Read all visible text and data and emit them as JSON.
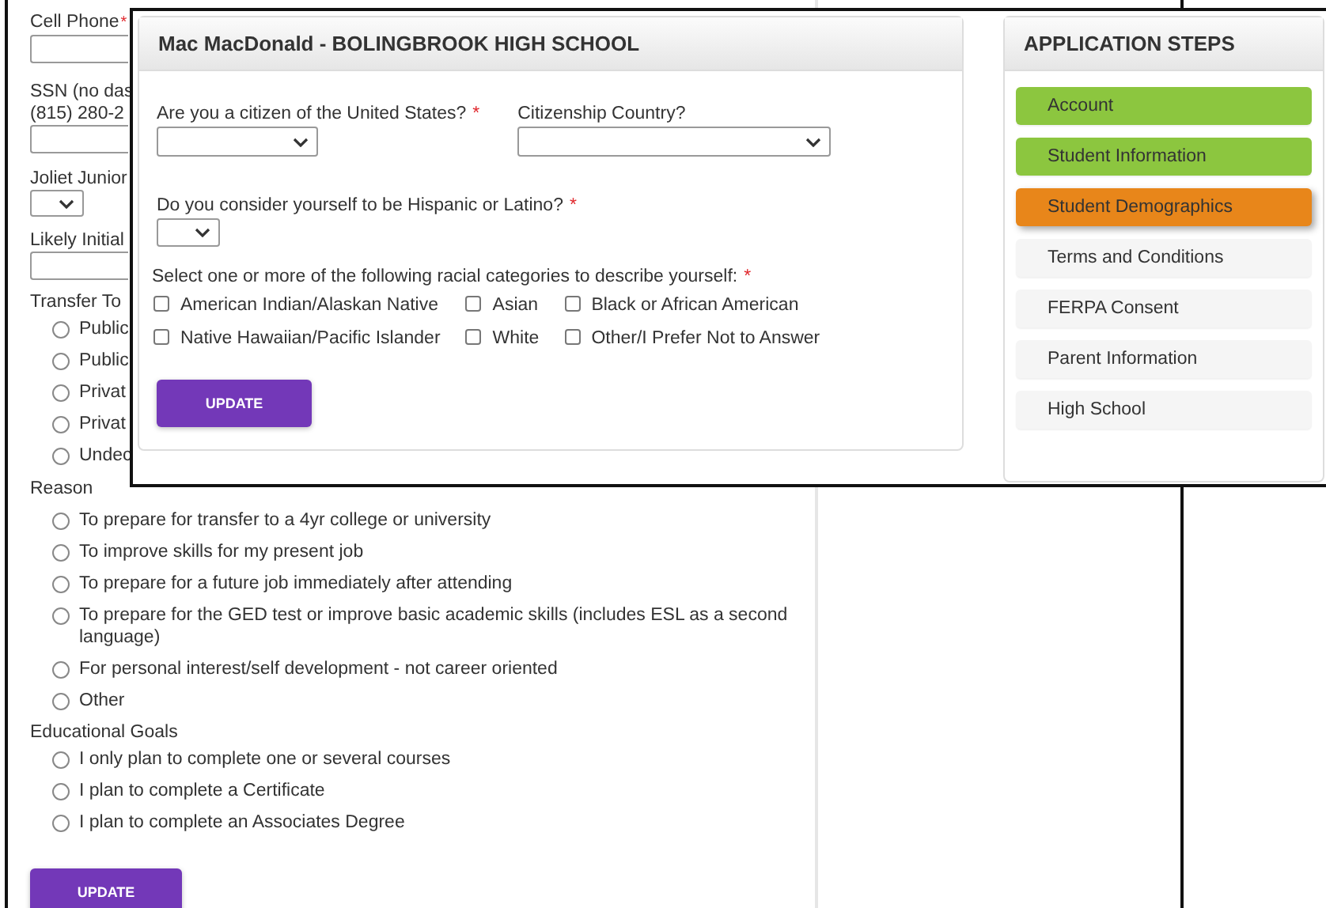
{
  "background_form": {
    "items": [
      {
        "kind": "input",
        "label": "Cell Phone",
        "mark": "*"
      },
      {
        "kind": "input",
        "label": "SSN (no das",
        "note": "(815) 280-2"
      },
      {
        "kind": "select",
        "label": "Joliet Junior"
      },
      {
        "kind": "input",
        "label": "Likely Initial"
      },
      {
        "kind": "radios",
        "label": "Transfer To",
        "options": [
          {
            "label": "Public",
            "checked": false
          },
          {
            "label": "Public",
            "checked": false
          },
          {
            "label": "Privat",
            "checked": false
          },
          {
            "label": "Privat",
            "checked": false
          },
          {
            "label": "Undec",
            "checked": false
          }
        ]
      },
      {
        "kind": "radios",
        "label": "Reason",
        "options": [
          {
            "label": "To prepare for transfer to a 4yr college or university",
            "checked": false
          },
          {
            "label": "To improve skills for my present job",
            "checked": false
          },
          {
            "label": "To prepare for a future job immediately after attending",
            "checked": false
          },
          {
            "label": "To prepare for the GED test or improve basic academic skills (includes ESL as a second language)",
            "checked": false
          },
          {
            "label": "For personal interest/self development - not career oriented",
            "checked": false
          },
          {
            "label": "Other",
            "checked": false
          }
        ]
      },
      {
        "kind": "radios",
        "label": "Educational Goals",
        "options": [
          {
            "label": "I only plan to complete one or several courses",
            "checked": false
          },
          {
            "label": "I plan to complete a Certificate",
            "checked": false
          },
          {
            "label": "I plan to complete an Associates Degree",
            "checked": false
          }
        ]
      }
    ],
    "button": "UPDATE"
  },
  "demographics_card": {
    "title": "Mac MacDonald - BOLINGBROOK HIGH SCHOOL",
    "citizen_question": {
      "label": "Are you a citizen of the United States?",
      "mark": "*"
    },
    "country_question": {
      "label": "Citizenship Country?"
    },
    "hispanic_question": {
      "label": "Do you consider yourself to be Hispanic or Latino?",
      "mark": "*"
    },
    "race_question": {
      "label": "Select one or more of the following racial categories to describe yourself:",
      "mark": "*",
      "options": [
        {
          "label": "American Indian/Alaskan Native",
          "checked": false
        },
        {
          "label": "Asian",
          "checked": false
        },
        {
          "label": "Black or African American",
          "checked": false
        },
        {
          "label": "Native Hawaiian/Pacific Islander",
          "checked": false
        },
        {
          "label": "White",
          "checked": false
        },
        {
          "label": "Other/I Prefer Not to Answer",
          "checked": false
        }
      ]
    },
    "button": "UPDATE"
  },
  "steps_card": {
    "title": "APPLICATION STEPS",
    "steps": [
      {
        "label": "Account",
        "done": true,
        "selected": false
      },
      {
        "label": "Student Information",
        "done": true,
        "selected": false
      },
      {
        "label": "Student Demographics",
        "done": false,
        "selected": true
      },
      {
        "label": "Terms and Conditions",
        "done": false,
        "selected": false
      },
      {
        "label": "FERPA Consent",
        "done": false,
        "selected": false
      },
      {
        "label": "Parent Information",
        "done": false,
        "selected": false
      },
      {
        "label": "High School",
        "done": false,
        "selected": false
      }
    ]
  }
}
